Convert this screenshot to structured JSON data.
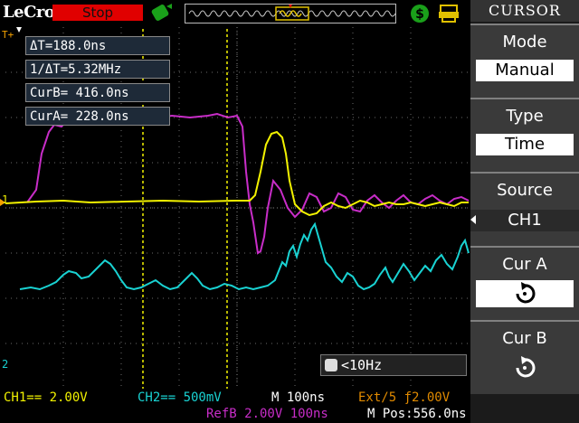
{
  "header": {
    "brand": "LeCroy",
    "run_state": "Stop"
  },
  "readouts": {
    "delta_t": "ΔT=188.0ns",
    "inv_delta_t": "1/ΔT=5.32MHz",
    "cur_b": "CurB= 416.0ns",
    "cur_a": "CurA= 228.0ns"
  },
  "freq_indicator": "<10Hz",
  "bottom": {
    "ch1": "CH1== 2.00V",
    "ch2": "CH2== 500mV",
    "timebase": "M 100ns",
    "trigger": "Ext/5 ƒ2.00V",
    "ref": "RefB 2.00V 100ns",
    "mpos": "M Pos:556.0ns"
  },
  "panel": {
    "title": "CURSOR",
    "mode_label": "Mode",
    "mode_value": "Manual",
    "type_label": "Type",
    "type_value": "Time",
    "source_label": "Source",
    "source_value": "CH1",
    "cura_label": "Cur A",
    "curb_label": "Cur B"
  },
  "markers": {
    "ch1": "1",
    "ch2": "2"
  },
  "colors": {
    "ch1": "#f2f200",
    "ch2": "#19d2d2",
    "ref": "#c82dc8",
    "trigger": "#e08a00",
    "stop_bg": "#e00000"
  }
}
